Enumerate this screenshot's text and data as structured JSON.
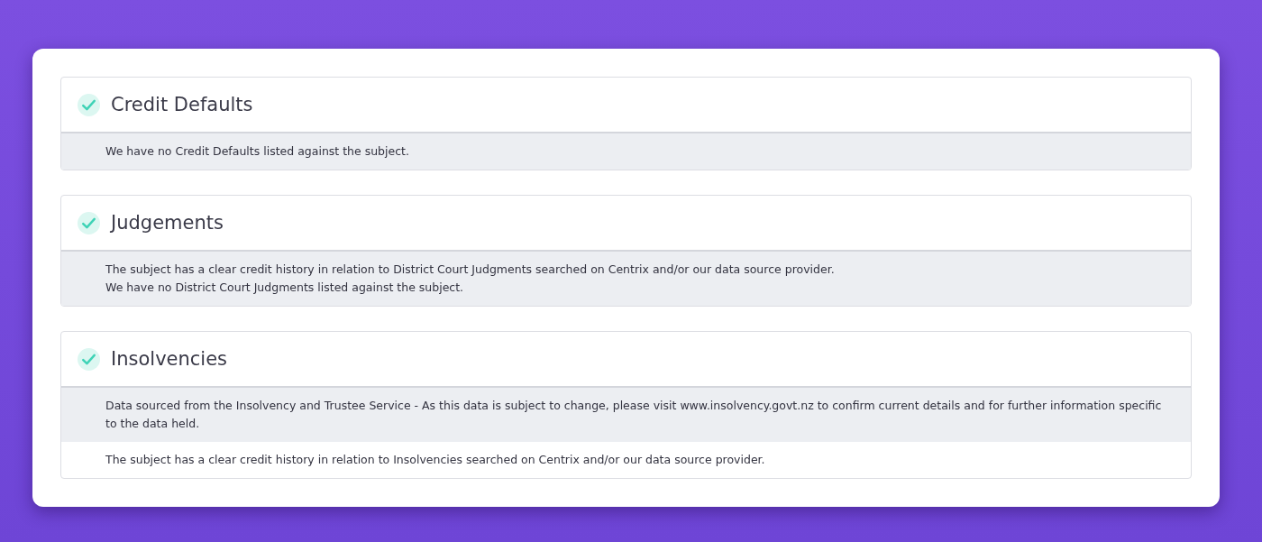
{
  "sections": [
    {
      "title": "Credit Defaults",
      "clear": true,
      "rows": [
        {
          "shaded": true,
          "lines": [
            "We have no Credit Defaults listed against the subject."
          ]
        }
      ]
    },
    {
      "title": "Judgements",
      "clear": true,
      "rows": [
        {
          "shaded": true,
          "lines": [
            "The subject has a clear credit history in relation to District Court Judgments searched on Centrix and/or our data source provider.",
            "We have no District Court Judgments listed against the subject."
          ]
        }
      ]
    },
    {
      "title": "Insolvencies",
      "clear": true,
      "rows": [
        {
          "shaded": true,
          "lines": [
            "Data sourced from the Insolvency and Trustee Service - As this data is subject to change, please visit www.insolvency.govt.nz to confirm current details and for further information specific to the data held."
          ]
        },
        {
          "shaded": false,
          "lines": [
            "The subject has a clear credit history in relation to Insolvencies searched on Centrix and/or our data source provider."
          ]
        }
      ]
    }
  ]
}
